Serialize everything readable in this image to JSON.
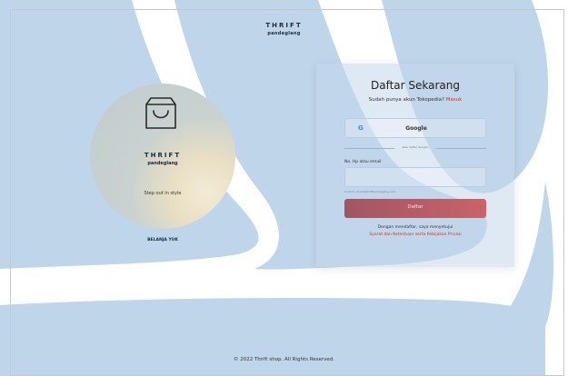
{
  "brand": {
    "name": "THRIFT",
    "sub": "pandeglang"
  },
  "promo": {
    "icon": "shopping-bag-icon",
    "name": "THRIFT",
    "sub": "pandeglang",
    "tagline": "Step out in style",
    "shop_link": "BELANJA YUK"
  },
  "register": {
    "title": "Daftar Sekarang",
    "has_account": "Sudah punya akun Tokopedia?",
    "login_link": "Masuk",
    "google_label": "Google",
    "google_icon": "google-icon",
    "divider_text": "atau daftar dengan",
    "field_label": "No. Hp atau email",
    "field_value": "",
    "field_hint": "Contoh: email@thriftpandeglang.com",
    "submit_label": "Daftar",
    "terms_line1": "Dengan mendaftar, saya menyetujui",
    "terms_line2": "Syarat dan Ketentuan serta Kebijakan Privasi"
  },
  "footer": {
    "copyright": "© 2022 Thrift shop. All Rights Reserved."
  },
  "colors": {
    "background_shape": "#bfd6ea",
    "accent": "#c0392b",
    "button": "#b45f67"
  }
}
